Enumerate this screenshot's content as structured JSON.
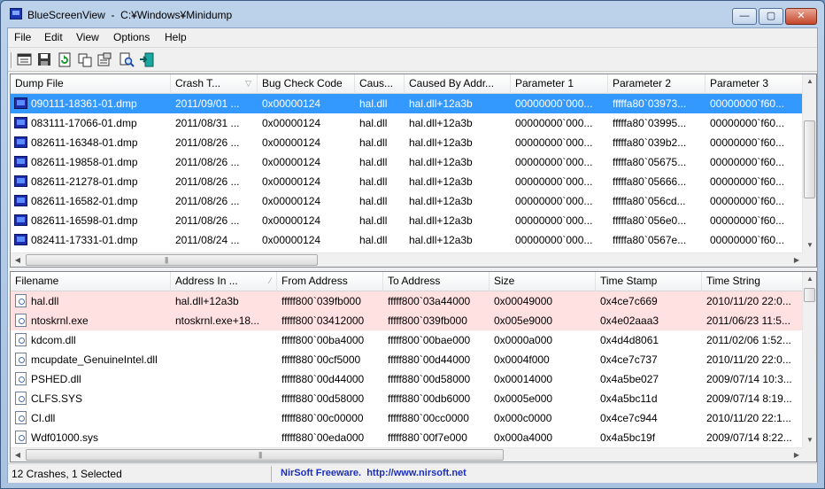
{
  "window": {
    "title": "BlueScreenView  -  C:¥Windows¥Minidump",
    "minimize_glyph": "—",
    "maximize_glyph": "▢",
    "close_glyph": "✕"
  },
  "menu": [
    "File",
    "Edit",
    "View",
    "Options",
    "Help"
  ],
  "toolbar": {
    "icons": [
      "html-report-icon",
      "save-icon",
      "refresh-icon",
      "copy-icon",
      "properties-icon",
      "find-icon",
      "exit-icon"
    ]
  },
  "top_table": {
    "columns": [
      "Dump File",
      "Crash T...",
      "Bug Check Code",
      "Caus...",
      "Caused By Addr...",
      "Parameter 1",
      "Parameter 2",
      "Parameter 3"
    ],
    "rows": [
      [
        "090111-18361-01.dmp",
        "2011/09/01 ...",
        "0x00000124",
        "hal.dll",
        "hal.dll+12a3b",
        "00000000`000...",
        "fffffa80`03973...",
        "00000000`f60..."
      ],
      [
        "083111-17066-01.dmp",
        "2011/08/31 ...",
        "0x00000124",
        "hal.dll",
        "hal.dll+12a3b",
        "00000000`000...",
        "fffffa80`03995...",
        "00000000`f60..."
      ],
      [
        "082611-16348-01.dmp",
        "2011/08/26 ...",
        "0x00000124",
        "hal.dll",
        "hal.dll+12a3b",
        "00000000`000...",
        "fffffa80`039b2...",
        "00000000`f60..."
      ],
      [
        "082611-19858-01.dmp",
        "2011/08/26 ...",
        "0x00000124",
        "hal.dll",
        "hal.dll+12a3b",
        "00000000`000...",
        "fffffa80`05675...",
        "00000000`f60..."
      ],
      [
        "082611-21278-01.dmp",
        "2011/08/26 ...",
        "0x00000124",
        "hal.dll",
        "hal.dll+12a3b",
        "00000000`000...",
        "fffffa80`05666...",
        "00000000`f60..."
      ],
      [
        "082611-16582-01.dmp",
        "2011/08/26 ...",
        "0x00000124",
        "hal.dll",
        "hal.dll+12a3b",
        "00000000`000...",
        "fffffa80`056cd...",
        "00000000`f60..."
      ],
      [
        "082611-16598-01.dmp",
        "2011/08/26 ...",
        "0x00000124",
        "hal.dll",
        "hal.dll+12a3b",
        "00000000`000...",
        "fffffa80`056e0...",
        "00000000`f60..."
      ],
      [
        "082411-17331-01.dmp",
        "2011/08/24 ...",
        "0x00000124",
        "hal.dll",
        "hal.dll+12a3b",
        "00000000`000...",
        "fffffa80`0567e...",
        "00000000`f60..."
      ]
    ],
    "selected_row": 0
  },
  "bottom_table": {
    "columns": [
      "Filename",
      "Address In ...",
      "From Address",
      "To Address",
      "Size",
      "Time Stamp",
      "Time String"
    ],
    "rows": [
      [
        "hal.dll",
        "hal.dll+12a3b",
        "fffff800`039fb000",
        "fffff800`03a44000",
        "0x00049000",
        "0x4ce7c669",
        "2010/11/20 22:0..."
      ],
      [
        "ntoskrnl.exe",
        "ntoskrnl.exe+18...",
        "fffff800`03412000",
        "fffff800`039fb000",
        "0x005e9000",
        "0x4e02aaa3",
        "2011/06/23 11:5..."
      ],
      [
        "kdcom.dll",
        "",
        "fffff800`00ba4000",
        "fffff800`00bae000",
        "0x0000a000",
        "0x4d4d8061",
        "2011/02/06 1:52..."
      ],
      [
        "mcupdate_GenuineIntel.dll",
        "",
        "fffff880`00cf5000",
        "fffff880`00d44000",
        "0x0004f000",
        "0x4ce7c737",
        "2010/11/20 22:0..."
      ],
      [
        "PSHED.dll",
        "",
        "fffff880`00d44000",
        "fffff880`00d58000",
        "0x00014000",
        "0x4a5be027",
        "2009/07/14 10:3..."
      ],
      [
        "CLFS.SYS",
        "",
        "fffff880`00d58000",
        "fffff880`00db6000",
        "0x0005e000",
        "0x4a5bc11d",
        "2009/07/14 8:19..."
      ],
      [
        "CI.dll",
        "",
        "fffff880`00c00000",
        "fffff880`00cc0000",
        "0x000c0000",
        "0x4ce7c944",
        "2010/11/20 22:1..."
      ],
      [
        "Wdf01000.sys",
        "",
        "fffff880`00eda000",
        "fffff880`00f7e000",
        "0x000a4000",
        "0x4a5bc19f",
        "2009/07/14 8:22..."
      ]
    ],
    "highlighted_rows": [
      0,
      1
    ]
  },
  "status": {
    "count_text": "12 Crashes, 1 Selected",
    "link_text": "NirSoft Freeware.  http://www.nirsoft.net"
  },
  "colors": {
    "selection": "#3399ff",
    "highlight_row": "#ffe1e1",
    "link": "#1d2fb8"
  }
}
